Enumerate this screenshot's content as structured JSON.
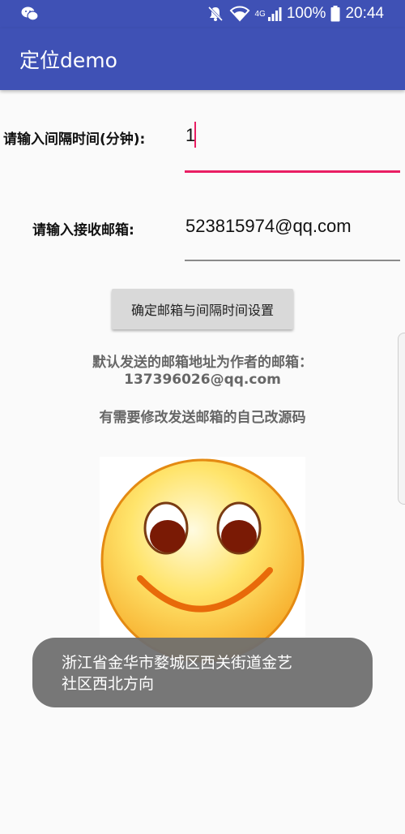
{
  "status_bar": {
    "battery": "100%",
    "time": "20:44",
    "network_type": "4G"
  },
  "app_bar": {
    "title": "定位demo"
  },
  "form": {
    "interval_label": "请输入间隔时间(分钟):",
    "interval_value": "1",
    "email_label": "请输入接收邮箱:",
    "email_value": "523815974@qq.com",
    "submit_label": "确定邮箱与间隔时间设置"
  },
  "info": {
    "line1": "默认发送的邮箱地址为作者的邮箱：",
    "line2": "137396026@qq.com",
    "line3": "有需要修改发送邮箱的自己改源码"
  },
  "toast": {
    "line1": "浙江省金华市婺城区西关街道金艺",
    "line2": "社区西北方向"
  },
  "colors": {
    "primary": "#3f51b5",
    "accent": "#e91e63",
    "toast_bg": "#6e6e6e"
  },
  "icons": {
    "status_left": "wechat-icon",
    "status_right": [
      "mute-icon",
      "wifi-icon",
      "signal-icon",
      "battery-icon"
    ],
    "image": "smiley-face"
  }
}
